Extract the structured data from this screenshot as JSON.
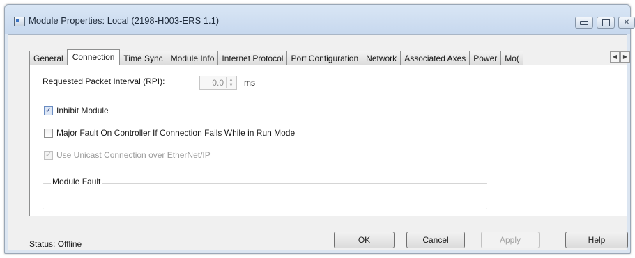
{
  "window": {
    "title": "Module Properties: Local (2198-H003-ERS 1.1)",
    "buttons": {
      "minimize_icon": "minimize-icon",
      "maximize_icon": "maximize-icon",
      "close_glyph": "✕"
    }
  },
  "tabs": [
    {
      "label": "General",
      "active": false
    },
    {
      "label": "Connection",
      "active": true
    },
    {
      "label": "Time Sync",
      "active": false
    },
    {
      "label": "Module Info",
      "active": false
    },
    {
      "label": "Internet Protocol",
      "active": false
    },
    {
      "label": "Port Configuration",
      "active": false
    },
    {
      "label": "Network",
      "active": false
    },
    {
      "label": "Associated Axes",
      "active": false
    },
    {
      "label": "Power",
      "active": false
    },
    {
      "label": "Mo(",
      "active": false
    }
  ],
  "tab_scroll": {
    "left": "◀",
    "right": "▶"
  },
  "connection": {
    "rpi_label": "Requested Packet Interval (RPI):",
    "rpi_value": "0.0",
    "rpi_unit": "ms",
    "spin_up": "▲",
    "spin_down": "▼",
    "inhibit_module": {
      "label": "Inhibit Module",
      "checked": true,
      "mark": "✓"
    },
    "major_fault": {
      "label": "Major Fault On Controller If Connection Fails While in Run Mode",
      "checked": false,
      "mark": ""
    },
    "unicast": {
      "label": "Use Unicast Connection over EtherNet/IP",
      "checked": true,
      "disabled": true,
      "mark": "✓"
    },
    "module_fault": {
      "legend": "Module Fault",
      "value": ""
    }
  },
  "status": {
    "label": "Status:",
    "value": "Offline"
  },
  "footer_buttons": {
    "ok": "OK",
    "cancel": "Cancel",
    "apply": "Apply",
    "help": "Help"
  }
}
